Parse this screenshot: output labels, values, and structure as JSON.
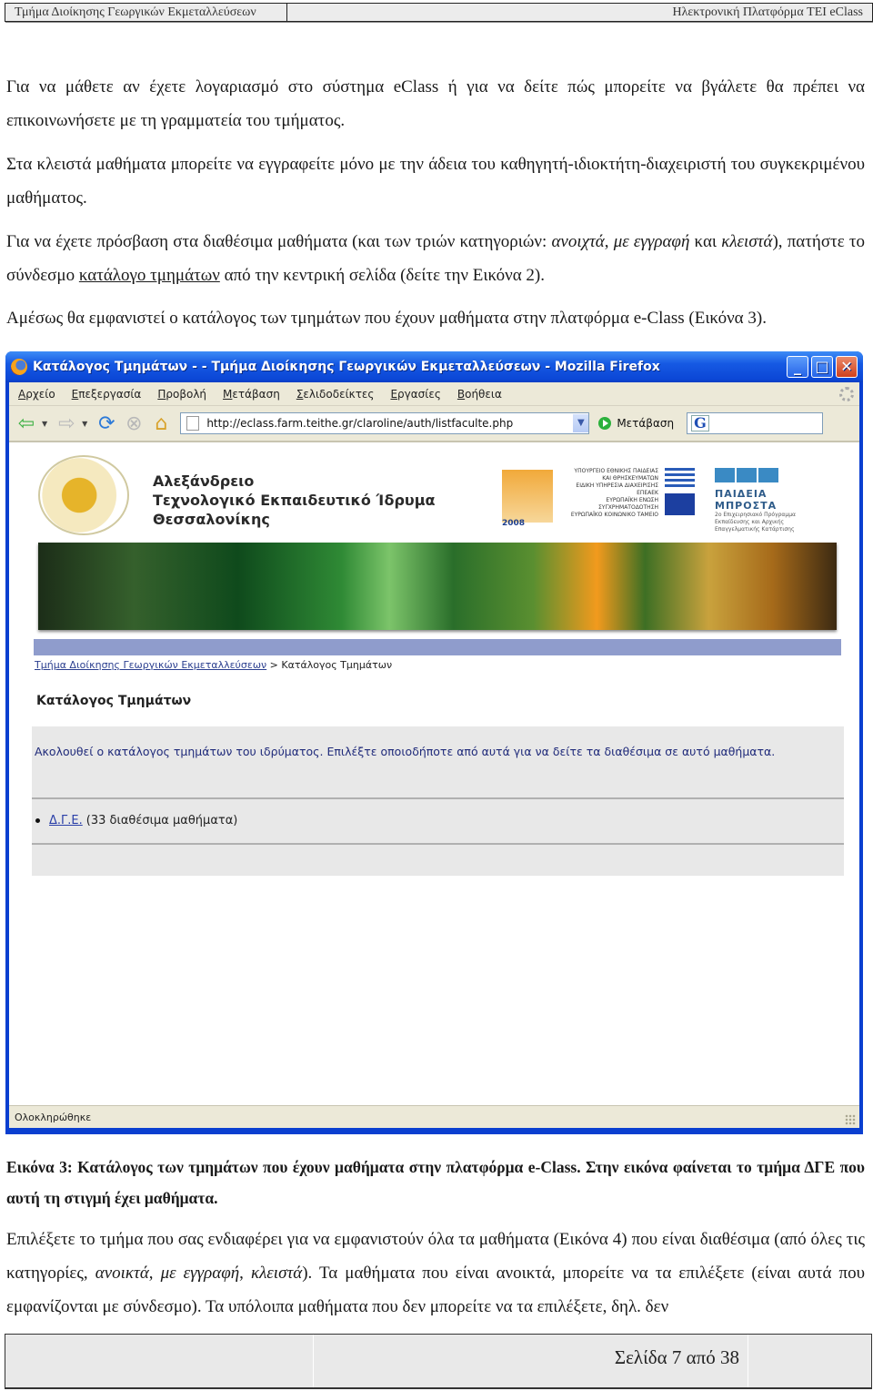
{
  "header": {
    "left": "Τμήμα Διοίκησης Γεωργικών Εκμεταλλεύσεων",
    "right": "Ηλεκτρονική Πλατφόρμα TEI eClass"
  },
  "paragraphs": {
    "p1": "Για να μάθετε αν έχετε λογαριασμό στο σύστημα eClass ή για να δείτε πώς μπορείτε να βγάλετε θα πρέπει να επικοινωνήσετε με τη γραμματεία του τμήματος.",
    "p2": "Στα κλειστά μαθήματα μπορείτε να εγγραφείτε μόνο με την άδεια του καθηγητή-ιδιοκτήτη-διαχειριστή του συγκεκριμένου μαθήματος.",
    "p3_a": "Για να έχετε πρόσβαση στα διαθέσιμα μαθήματα (και των τριών κατηγοριών: ",
    "p3_open": "ανοιχτά",
    "p3_sep1": ", ",
    "p3_reg": "με εγγραφή",
    "p3_and": " και ",
    "p3_closed": "κλειστά",
    "p3_b": "), πατήστε το σύνδεσμο ",
    "p3_link": "κατάλογο τμημάτων",
    "p3_c": "  από την κεντρική σελίδα (δείτε την Εικόνα 2).",
    "p4": "Αμέσως θα εμφανιστεί ο κατάλογος των τμημάτων που έχουν μαθήματα στην πλατφόρμα e-Class (Εικόνα 3).",
    "caption": "Εικόνα 3: Κατάλογος των τμημάτων που έχουν μαθήματα στην πλατφόρμα e-Class. Στην εικόνα φαίνεται το τμήμα ΔΓΕ που αυτή τη στιγμή έχει μαθήματα.",
    "p5_a": " Επιλέξετε το τμήμα που σας ενδιαφέρει για να εμφανιστούν όλα τα μαθήματα (Εικόνα 4) που είναι διαθέσιμα (από όλες τις κατηγορίες, ",
    "p5_open": "ανοικτά",
    "p5_sep1": ", ",
    "p5_reg": "με εγγραφή",
    "p5_sep2": ", ",
    "p5_closed": "κλειστά",
    "p5_b": "). Τα μαθήματα που είναι ανοικτά, μπορείτε να τα επιλέξετε (είναι αυτά που εμφανίζονται με σύνδεσμο). Τα υπόλοιπα μαθήματα που δεν μπορείτε να τα επιλέξετε, δηλ. δεν"
  },
  "browser": {
    "title": "Κατάλογος Τμημάτων - - Τμήμα Διοίκησης Γεωργικών Εκμεταλλεύσεων - Mozilla Firefox",
    "menu": [
      "Αρχείο",
      "Επεξεργασία",
      "Προβολή",
      "Μετάβαση",
      "Σελιδοδείκτες",
      "Εργασίες",
      "Βοήθεια"
    ],
    "url": "http://eclass.farm.teithe.gr/claroline/auth/listfaculte.php",
    "go_label": "Μετάβαση",
    "search_engine": "G",
    "status": "Ολοκληρώθηκε",
    "icons": {
      "back": "back-arrow-icon",
      "forward": "forward-arrow-icon",
      "reload": "reload-icon",
      "stop": "stop-icon",
      "home": "home-icon"
    }
  },
  "site": {
    "institution_lines": [
      "Αλεξάνδρειο",
      "Τεχνολογικό Εκπαιδευτικό Ίδρυμα",
      "Θεσσαλονίκης"
    ],
    "sponsor_year": "2008",
    "ministry_lines": [
      "ΥΠΟΥΡΓΕΙΟ ΕΘΝΙΚΗΣ ΠΑΙΔΕΙΑΣ ΚΑΙ ΘΡΗΣΚΕΥΜΑΤΩΝ",
      "ΕΙΔΙΚΗ ΥΠΗΡΕΣΙΑ ΔΙΑΧΕΙΡΙΣΗΣ ΕΠΕΑΕΚ",
      "ΕΥΡΩΠΑΪΚΗ ΕΝΩΣΗ",
      "ΣΥΓΧΡΗΜΑΤΟΔΟΤΗΣΗ",
      "ΕΥΡΩΠΑΪΚΟ ΚΟΙΝΩΝΙΚΟ ΤΑΜΕΙΟ"
    ],
    "paideia_name": "ΠΑΙΔΕΙΑ ΜΠΡΟΣΤΑ",
    "paideia_sub": [
      "2ο Επιχειρησιακό Πρόγραμμα",
      "Εκπαίδευσης και Αρχικής",
      "Επαγγελματικής Κατάρτισης"
    ],
    "breadcrumb_link": "Τμήμα Διοίκησης Γεωργικών Εκμεταλλεύσεων",
    "breadcrumb_sep": " > ",
    "breadcrumb_current": "Κατάλογος Τμημάτων",
    "page_heading": "Κατάλογος Τμημάτων",
    "intro": "Ακολουθεί ο κατάλογος τμημάτων του ιδρύματος. Επιλέξτε οποιοδήποτε από αυτά για να δείτε τα διαθέσιμα σε αυτό μαθήματα.",
    "departments": [
      {
        "name": "Δ.Γ.Ε.",
        "count_text": "(33 διαθέσιμα μαθήματα)"
      }
    ]
  },
  "footer": {
    "page_label": "Σελίδα 7 από 38"
  }
}
